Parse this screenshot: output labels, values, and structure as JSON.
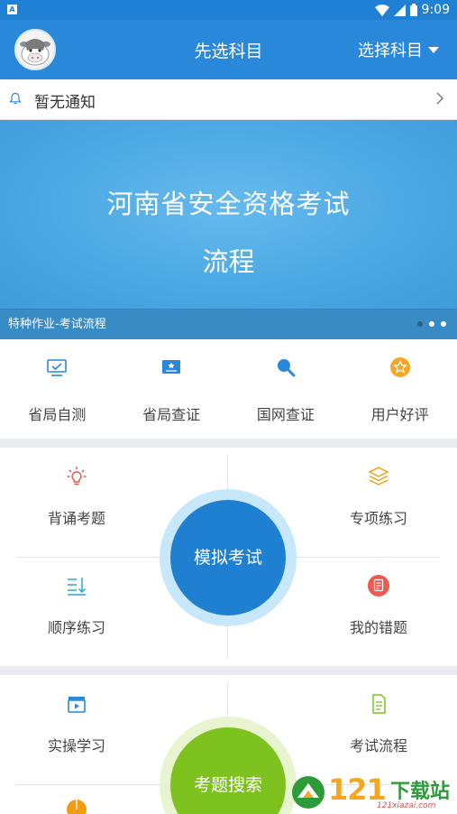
{
  "status_bar": {
    "notification_icon": "A",
    "time": "9:09"
  },
  "header": {
    "title": "先选科目",
    "subject_select": "选择科目"
  },
  "notice": {
    "text": "暂无通知"
  },
  "banner": {
    "line1": "河南省安全资格考试",
    "line2": "流程",
    "caption": "特种作业-考试流程",
    "dots": 3,
    "active_dot": 0
  },
  "tools": [
    {
      "label": "省局自测",
      "icon": "monitor-check-icon"
    },
    {
      "label": "省局查证",
      "icon": "certificate-icon"
    },
    {
      "label": "国网查证",
      "icon": "search-icon"
    },
    {
      "label": "用户好评",
      "icon": "star-icon"
    }
  ],
  "practice": {
    "top_left": "背诵考题",
    "top_right": "专项练习",
    "bottom_left": "顺序练习",
    "bottom_right": "我的错题",
    "center": "模拟考试"
  },
  "study": {
    "top_left": "实操学习",
    "top_right": "考试流程",
    "center": "考题搜索"
  },
  "watermark": {
    "number": "121",
    "name": "下载站",
    "url": "121xiazai.com"
  },
  "colors": {
    "primary": "#2a88db",
    "status_bar": "#1f80d4",
    "banner": "#4dabe6",
    "practice_circle": "#1f7fd0",
    "search_circle": "#7dc21e",
    "separator": "#e9ebee"
  }
}
